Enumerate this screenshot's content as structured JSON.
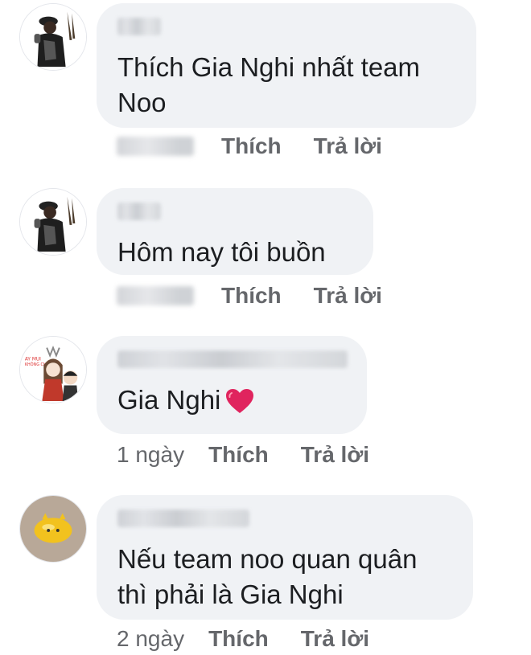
{
  "comments": [
    {
      "text": "Thích Gia Nghi nhất team\nNoo",
      "time": "",
      "like": "Thích",
      "reply": "Trả lời"
    },
    {
      "text": "Hôm nay tôi buồn",
      "time": "",
      "like": "Thích",
      "reply": "Trả lời"
    },
    {
      "text": "Gia Nghi",
      "time": "1 ngày",
      "like": "Thích",
      "reply": "Trả lời"
    },
    {
      "text": "Nếu team noo quan quân\nthì phải là Gia Nghi",
      "time": "2 ngày",
      "like": "Thích",
      "reply": "Trả lời"
    }
  ],
  "colors": {
    "bubble": "#f0f2f5",
    "meta": "#65676b",
    "heart": "#e0245e"
  }
}
